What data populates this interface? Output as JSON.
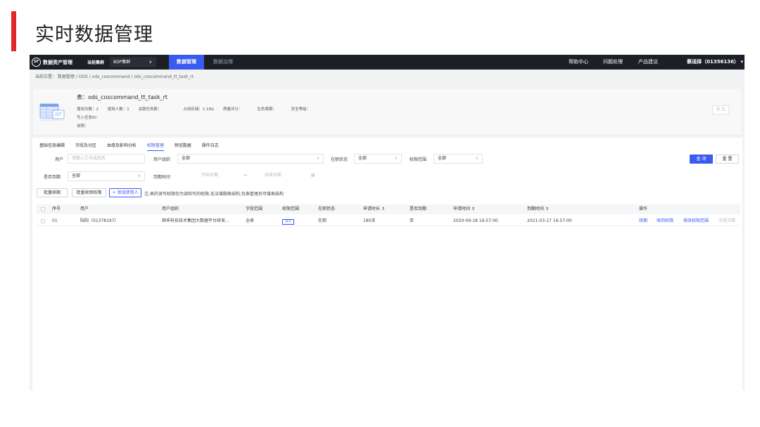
{
  "slide": {
    "title": "实时数据管理"
  },
  "topbar": {
    "logo": "SF",
    "brand": "数据资产管理",
    "cluster_label": "当前集群",
    "cluster_value": "BDP集群",
    "tabs": [
      "数据管理",
      "数据治理"
    ],
    "right_nav": [
      "帮助中心",
      "问题处理",
      "产品建议"
    ],
    "user": "蔡适择（01356136）"
  },
  "breadcrumb": "当前位置：  数据管理 / ODS / ods_coscommand / ods_coscommand_tt_task_rt",
  "table_info": {
    "name": "表：ods_coscommand_tt_task_rt",
    "meta": [
      "使用次数：2",
      "使用人数：1",
      "关联任务数：",
      "占用存储：1.18G",
      "质量评分：",
      "生命周期：",
      "安全等级："
    ],
    "write_task": "写入任务ID：",
    "description": "说明：",
    "watch_button": "关 注"
  },
  "tabs": [
    "基础信息编辑",
    "字段及分区",
    "血缘及影响分析",
    "权限管理",
    "预览数据",
    "操作日志"
  ],
  "filters": {
    "user_label": "用户",
    "user_placeholder": "请输入工号或姓名",
    "org_label": "用户组织",
    "org_value": "全部",
    "status_label": "在职状态",
    "status_value": "全部",
    "scope_label": "权限范围",
    "scope_value": "全部",
    "expired_label": "是否到期",
    "expired_value": "全部",
    "expiry_label": "到期时间",
    "start_placeholder": "开始日期",
    "end_placeholder": "结束日期",
    "query_button": "查 询",
    "reset_button": "重 置"
  },
  "actions": {
    "batch_renew": "批量续期",
    "batch_revoke": "批量收回权限",
    "add_user": "+ 添加使用人",
    "note": "注:表的读写权限仅为读和写的权限,无法增删表结构,仅表管理员可增表结构"
  },
  "table": {
    "headers": [
      "序号",
      "用户",
      "用户组织",
      "字段范围",
      "权限范围",
      "在职状态",
      "申请时长 ⇕",
      "是否到期",
      "申请时间 ⇕",
      "到期时间 ⇕",
      "操作"
    ],
    "rows": [
      {
        "index": "01",
        "user": "陆阳（01378197）",
        "org": "顺丰科技技术集团大数据平台研发...",
        "field_scope": "全表",
        "perm_scope": "读写",
        "status": "在职",
        "duration": "180天",
        "expired": "否",
        "apply_time": "2020-09-18 16:57:00",
        "expiry_time": "2021-03-17 16:57:00",
        "ops": [
          "续期",
          "收回权限",
          "修改权限范围",
          "字段详情"
        ]
      }
    ]
  }
}
